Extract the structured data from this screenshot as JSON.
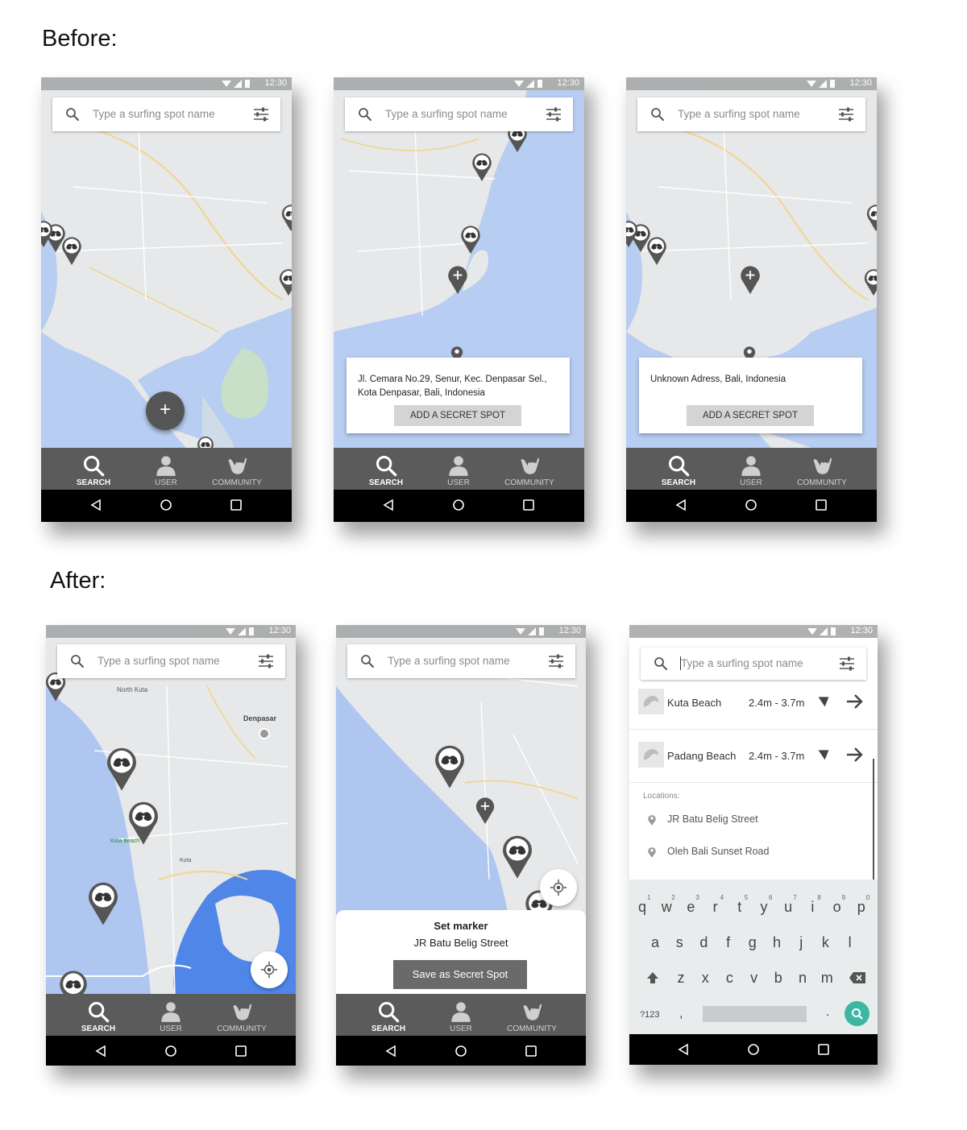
{
  "headings": {
    "before": "Before:",
    "after": "After:"
  },
  "status_time": "12:30",
  "search_placeholder": "Type a surfing spot name",
  "nav": {
    "search": "SEARCH",
    "user": "USER",
    "community": "COMMUNITY"
  },
  "before": {
    "screen2": {
      "address": "Jl. Cemara No.29, Senur, Kec. Denpasar Sel., Kota Denpasar, Bali, Indonesia",
      "button": "ADD A SECRET SPOT"
    },
    "screen3": {
      "address": "Unknown Adress, Bali, Indonesia",
      "button": "ADD A SECRET SPOT"
    }
  },
  "after": {
    "map_labels": {
      "city": "Denpasar",
      "north_kuta": "North Kuta",
      "kuta_beach": "Kuta Beach",
      "kuta": "Kuta"
    },
    "screen5": {
      "title": "Set marker",
      "street": "JR Batu Belig Street",
      "button": "Save as Secret Spot"
    },
    "screen6": {
      "spots": [
        {
          "name": "Kuta Beach",
          "wave": "2.4m - 3.7m"
        },
        {
          "name": "Padang Beach",
          "wave": "2.4m - 3.7m"
        }
      ],
      "locations_label": "Locations:",
      "locations": [
        "JR Batu Belig Street",
        "Oleh Bali Sunset Road"
      ],
      "keyboard": {
        "row1": [
          "q",
          "w",
          "e",
          "r",
          "t",
          "y",
          "u",
          "i",
          "o",
          "p"
        ],
        "row1_nums": [
          "1",
          "2",
          "3",
          "4",
          "5",
          "6",
          "7",
          "8",
          "9",
          "0"
        ],
        "row2": [
          "a",
          "s",
          "d",
          "f",
          "g",
          "h",
          "j",
          "k",
          "l"
        ],
        "row3": [
          "z",
          "x",
          "c",
          "v",
          "b",
          "n",
          "m"
        ],
        "symbols": "?123",
        "comma": ",",
        "period": "."
      }
    }
  },
  "colors": {
    "nav_bg": "#5b5b5b",
    "sea": "#b7cdf1",
    "sea_dark": "#4f86e8",
    "teal": "#3db7a4",
    "pin": "#5a5a5a"
  }
}
